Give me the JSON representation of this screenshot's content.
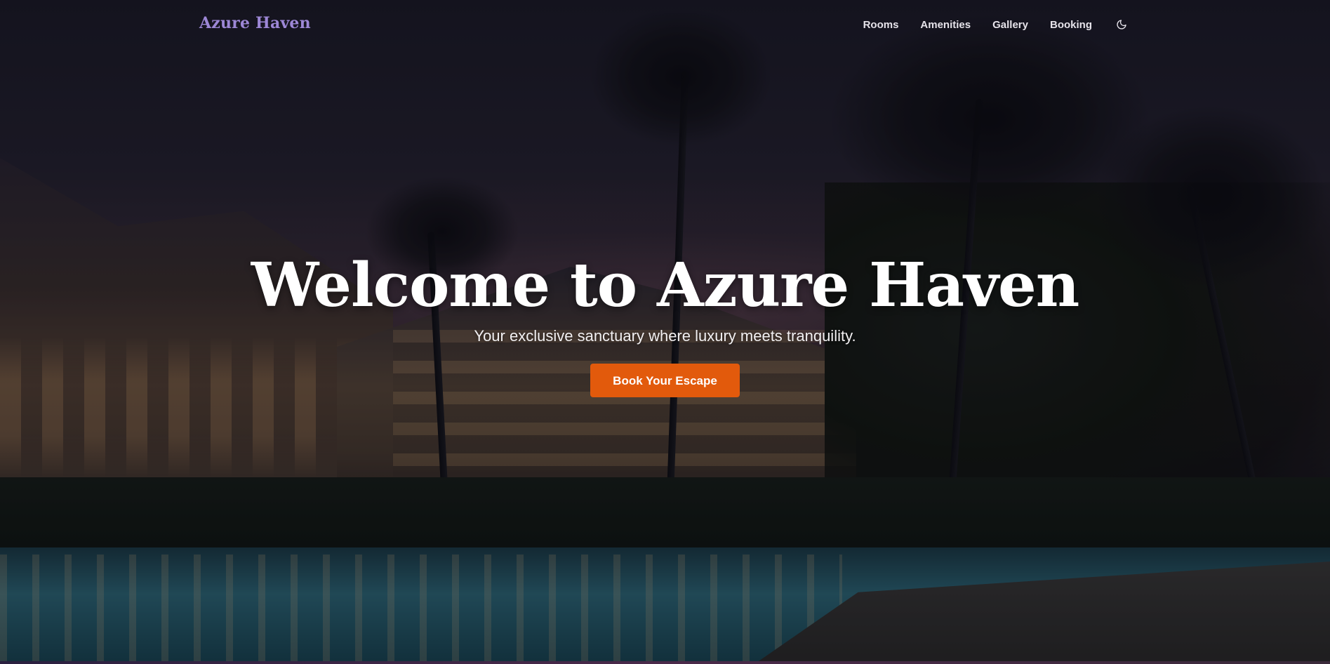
{
  "brand": {
    "name": "Azure Haven"
  },
  "nav": {
    "items": [
      {
        "label": "Rooms"
      },
      {
        "label": "Amenities"
      },
      {
        "label": "Gallery"
      },
      {
        "label": "Booking"
      }
    ],
    "theme_toggle_icon": "moon-icon"
  },
  "hero": {
    "title": "Welcome to Azure Haven",
    "subtitle": "Your exclusive sanctuary where luxury meets tranquility.",
    "cta_label": "Book Your Escape",
    "cta_color": "#e25a0c",
    "background": "night resort with palm trees and pool"
  },
  "colors": {
    "brand": "#9d87d6",
    "accent": "#e25a0c",
    "text": "#ffffff"
  }
}
